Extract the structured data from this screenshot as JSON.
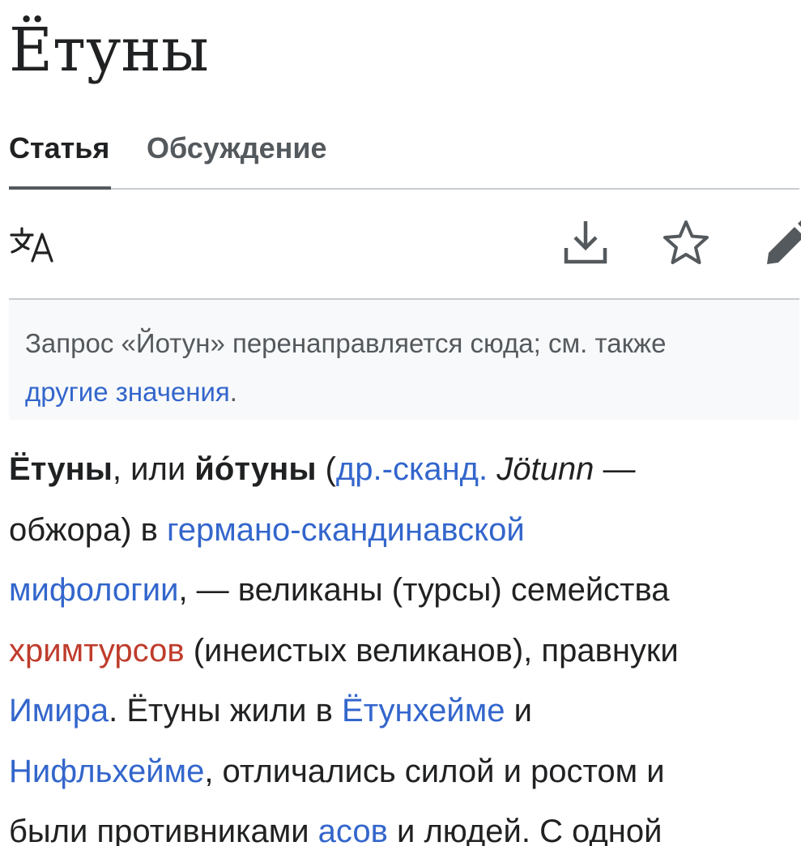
{
  "page": {
    "title": "Ётуны"
  },
  "tabs": [
    {
      "label": "Статья",
      "active": true
    },
    {
      "label": "Обсуждение",
      "active": false
    }
  ],
  "toolbar": {
    "icons": [
      "language-icon",
      "download-icon",
      "star-icon",
      "edit-pencil-icon"
    ]
  },
  "hatnote": {
    "text": "Запрос «Йотун» перенаправляется сюда; см. также",
    "link": "другие значения",
    "end": "."
  },
  "article": {
    "lines": [
      [
        {
          "kind": "bold",
          "text": "Ётуны"
        },
        {
          "kind": "text",
          "text": ", или "
        },
        {
          "kind": "bold",
          "text": "йо́туны"
        },
        {
          "kind": "text",
          "text": " ("
        },
        {
          "kind": "link",
          "text": "др.-сканд."
        },
        {
          "kind": "text",
          "text": " "
        },
        {
          "kind": "italic",
          "text": "Jötunn"
        },
        {
          "kind": "text",
          "text": " —"
        }
      ],
      [
        {
          "kind": "text",
          "text": "обжора) в "
        },
        {
          "kind": "link",
          "text": "германо-скандинавской"
        }
      ],
      [
        {
          "kind": "link",
          "text": "мифологии"
        },
        {
          "kind": "text",
          "text": ", — великаны (турсы) семейства"
        }
      ],
      [
        {
          "kind": "redlink",
          "text": "хримтурсов"
        },
        {
          "kind": "text",
          "text": " (инеистых великанов), правнуки"
        }
      ],
      [
        {
          "kind": "link",
          "text": "Имира"
        },
        {
          "kind": "text",
          "text": ". Ётуны жили в "
        },
        {
          "kind": "link",
          "text": "Ётунхейме"
        },
        {
          "kind": "text",
          "text": " и"
        }
      ],
      [
        {
          "kind": "link",
          "text": "Нифльхейме"
        },
        {
          "kind": "text",
          "text": ", отличались силой и ростом и"
        }
      ],
      [
        {
          "kind": "text",
          "text": "были противниками "
        },
        {
          "kind": "link",
          "text": "асов"
        },
        {
          "kind": "text",
          "text": " и людей. С одной"
        }
      ]
    ]
  },
  "colors": {
    "link": "#3366cc",
    "redlink": "#bf3c2c",
    "text": "#202122",
    "muted": "#54595d",
    "hatnote_bg": "#f8f9fa",
    "border": "#c8ccd1"
  }
}
